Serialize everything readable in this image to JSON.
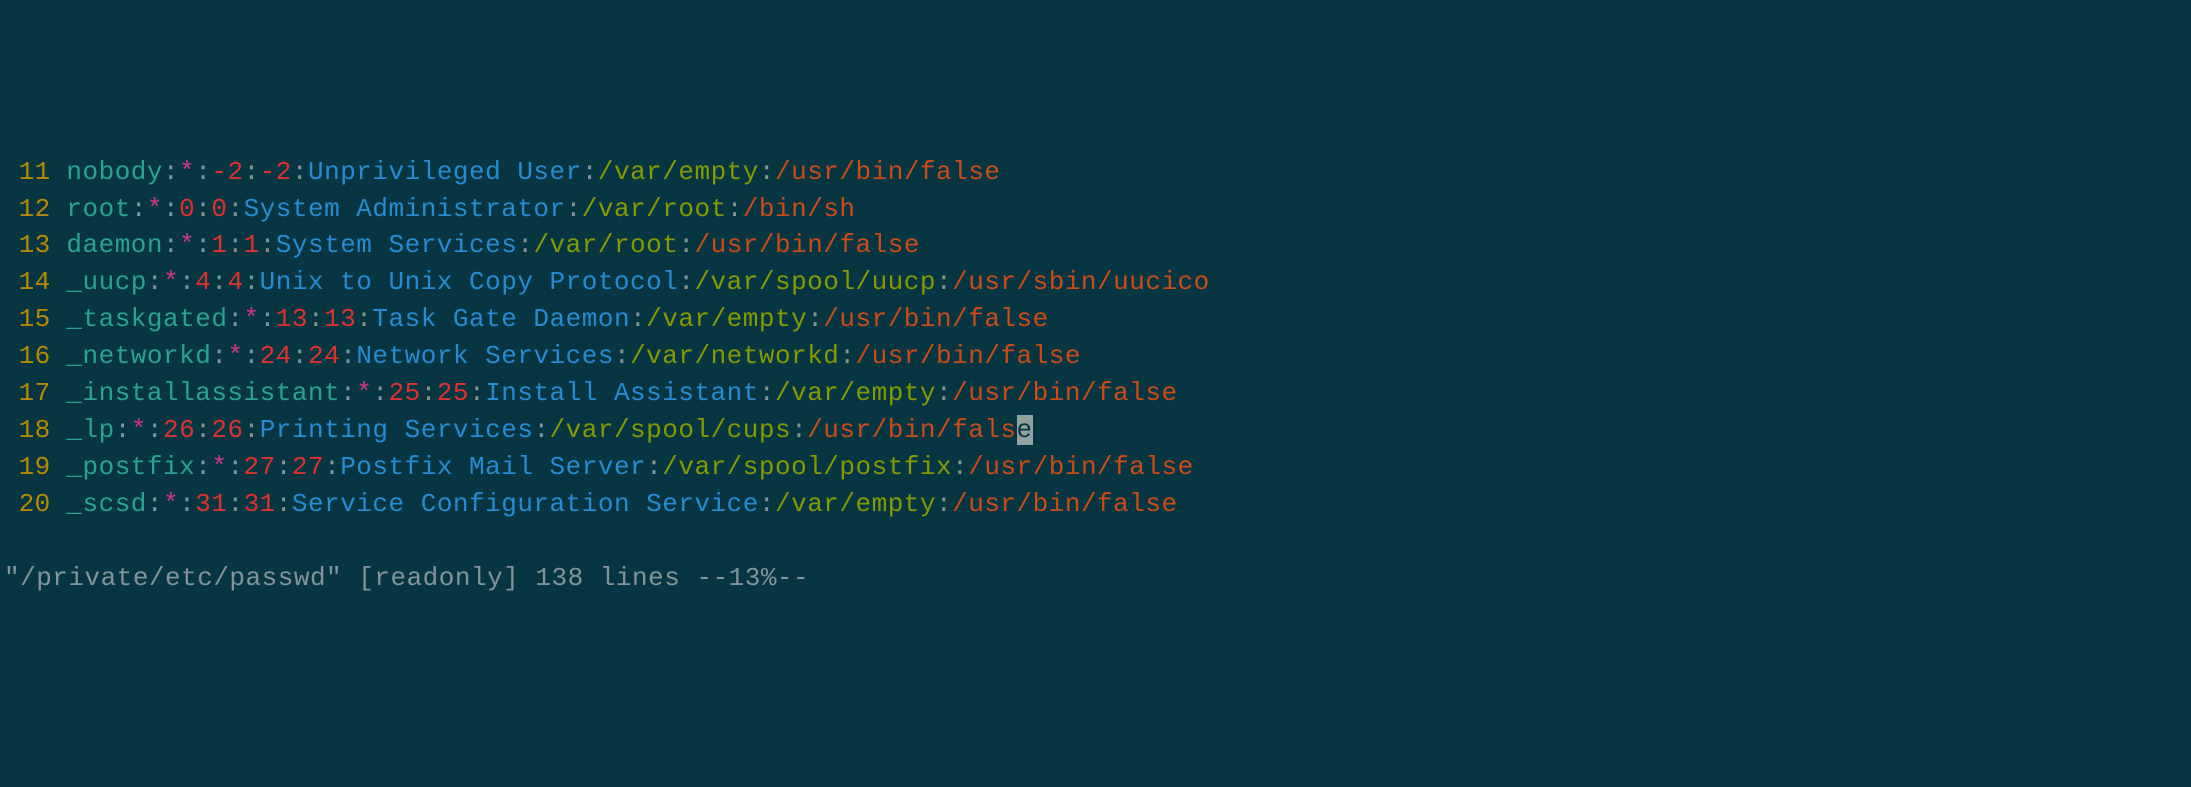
{
  "lines": [
    {
      "n": "11",
      "user": "nobody",
      "pw": "*",
      "uid": "-2",
      "gid": "-2",
      "gecos": "Unprivileged User",
      "home": "/var/empty",
      "shell": "/usr/bin/false"
    },
    {
      "n": "12",
      "user": "root",
      "pw": "*",
      "uid": "0",
      "gid": "0",
      "gecos": "System Administrator",
      "home": "/var/root",
      "shell": "/bin/sh"
    },
    {
      "n": "13",
      "user": "daemon",
      "pw": "*",
      "uid": "1",
      "gid": "1",
      "gecos": "System Services",
      "home": "/var/root",
      "shell": "/usr/bin/false"
    },
    {
      "n": "14",
      "user": "_uucp",
      "pw": "*",
      "uid": "4",
      "gid": "4",
      "gecos": "Unix to Unix Copy Protocol",
      "home": "/var/spool/uucp",
      "shell": "/usr/sbin/uucico"
    },
    {
      "n": "15",
      "user": "_taskgated",
      "pw": "*",
      "uid": "13",
      "gid": "13",
      "gecos": "Task Gate Daemon",
      "home": "/var/empty",
      "shell": "/usr/bin/false"
    },
    {
      "n": "16",
      "user": "_networkd",
      "pw": "*",
      "uid": "24",
      "gid": "24",
      "gecos": "Network Services",
      "home": "/var/networkd",
      "shell": "/usr/bin/false"
    },
    {
      "n": "17",
      "user": "_installassistant",
      "pw": "*",
      "uid": "25",
      "gid": "25",
      "gecos": "Install Assistant",
      "home": "/var/empty",
      "shell": "/usr/bin/false"
    },
    {
      "n": "18",
      "user": "_lp",
      "pw": "*",
      "uid": "26",
      "gid": "26",
      "gecos": "Printing Services",
      "home": "/var/spool/cups",
      "shell": "/usr/bin/false",
      "cursorAtLast": true
    },
    {
      "n": "19",
      "user": "_postfix",
      "pw": "*",
      "uid": "27",
      "gid": "27",
      "gecos": "Postfix Mail Server",
      "home": "/var/spool/postfix",
      "shell": "/usr/bin/false"
    },
    {
      "n": "20",
      "user": "_scsd",
      "pw": "*",
      "uid": "31",
      "gid": "31",
      "gecos": "Service Configuration Service",
      "home": "/var/empty",
      "shell": "/usr/bin/false"
    }
  ],
  "status": "\"/private/etc/passwd\" [readonly] 138 lines --13%--"
}
